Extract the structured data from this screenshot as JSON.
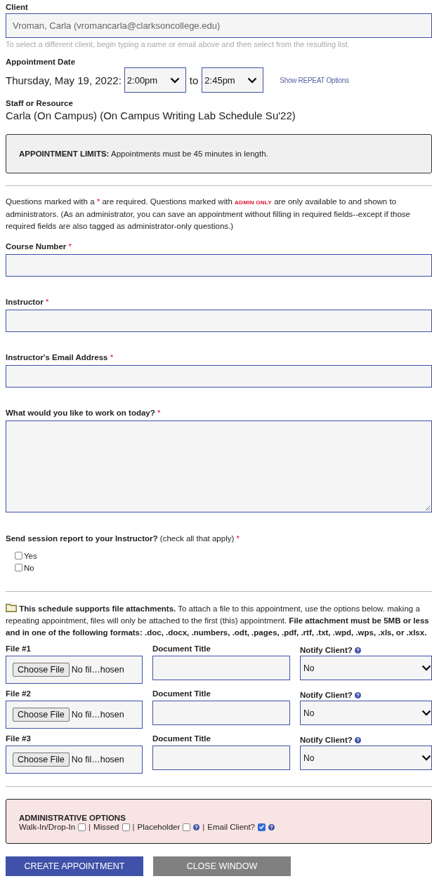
{
  "client": {
    "label": "Client",
    "value": "Vroman, Carla (vromancarla@clarksoncollege.edu)",
    "hint": "To select a different client, begin typing a name or email above and then select from the resulting list."
  },
  "appointment_date": {
    "label": "Appointment Date",
    "date": "Thursday, May 19, 2022:",
    "start": "2:00pm",
    "separator": "to",
    "end": "2:45pm",
    "repeat_link": "Show REPEAT Options"
  },
  "staff": {
    "label": "Staff or Resource",
    "value": "Carla (On Campus) (On Campus Writing Lab Schedule Su'22)"
  },
  "limits": {
    "title": "APPOINTMENT LIMITS:",
    "text": "Appointments must be 45 minutes in length."
  },
  "intro": [
    {
      "kind": "text",
      "text": "Questions marked with a "
    },
    {
      "kind": "required",
      "text": "*"
    },
    {
      "kind": "text",
      "text": " are required. Questions marked with "
    },
    {
      "kind": "admin",
      "text": "ADMIN ONLY"
    },
    {
      "kind": "text",
      "text": " are only available to and shown to administrators. (As an administrator, you can save an appointment without filling in required fields--except if those required fields are also tagged as administrator-only questions.)"
    }
  ],
  "questions": [
    {
      "kind": "text",
      "label": "Course Number",
      "required_mark": "*"
    },
    {
      "kind": "text",
      "label": "Instructor",
      "required_mark": "*"
    },
    {
      "kind": "text",
      "label": "Instructor's Email Address",
      "required_mark": "*"
    },
    {
      "kind": "textarea",
      "label": "What would you like to work on today?",
      "required_mark": "*"
    },
    {
      "kind": "checkboxes",
      "label": "Send session report to your Instructor?",
      "note": "(check all that apply)",
      "required_mark": "*",
      "options": [
        {
          "label": "Yes",
          "checked": false
        },
        {
          "label": "No",
          "checked": false
        }
      ]
    }
  ],
  "attachments": {
    "notice": "**This schedule supports file attachments.** To attach a file to this appointment, use the options below. making a repeating appointment, files will only be attached to the first (this) appointment. **File attachment must be 5MB or less and in one of the following formats: .doc, .docx, .numbers, .odt, .pages, .pdf, .rtf, .txt, .wpd, .wps, .xls, or .xlsx.**"
  },
  "files": [
    {
      "label": "File #1",
      "button": "Choose File",
      "status": "No fil…hosen",
      "title_label": "Document Title",
      "notify_label": "Notify Client?",
      "notify_value": "No"
    },
    {
      "label": "File #2",
      "button": "Choose File",
      "status": "No fil…hosen",
      "title_label": "Document Title",
      "notify_label": "Notify Client?",
      "notify_value": "No"
    },
    {
      "label": "File #3",
      "button": "Choose File",
      "status": "No fil…hosen",
      "title_label": "Document Title",
      "notify_label": "Notify Client?",
      "notify_value": "No"
    }
  ],
  "admin": {
    "title": "ADMINISTRATIVE OPTIONS",
    "separator": "|",
    "options": [
      {
        "label": "Walk-In/Drop-In",
        "checked": false,
        "help": false
      },
      {
        "label": "Missed",
        "checked": false,
        "help": false
      },
      {
        "label": "Placeholder",
        "checked": false,
        "help": true
      },
      {
        "label": "Email Client?",
        "checked": true,
        "help": true
      }
    ]
  },
  "buttons": [
    {
      "kind": "primary",
      "label": "CREATE APPOINTMENT"
    },
    {
      "kind": "secondary",
      "label": "CLOSE WINDOW"
    }
  ]
}
